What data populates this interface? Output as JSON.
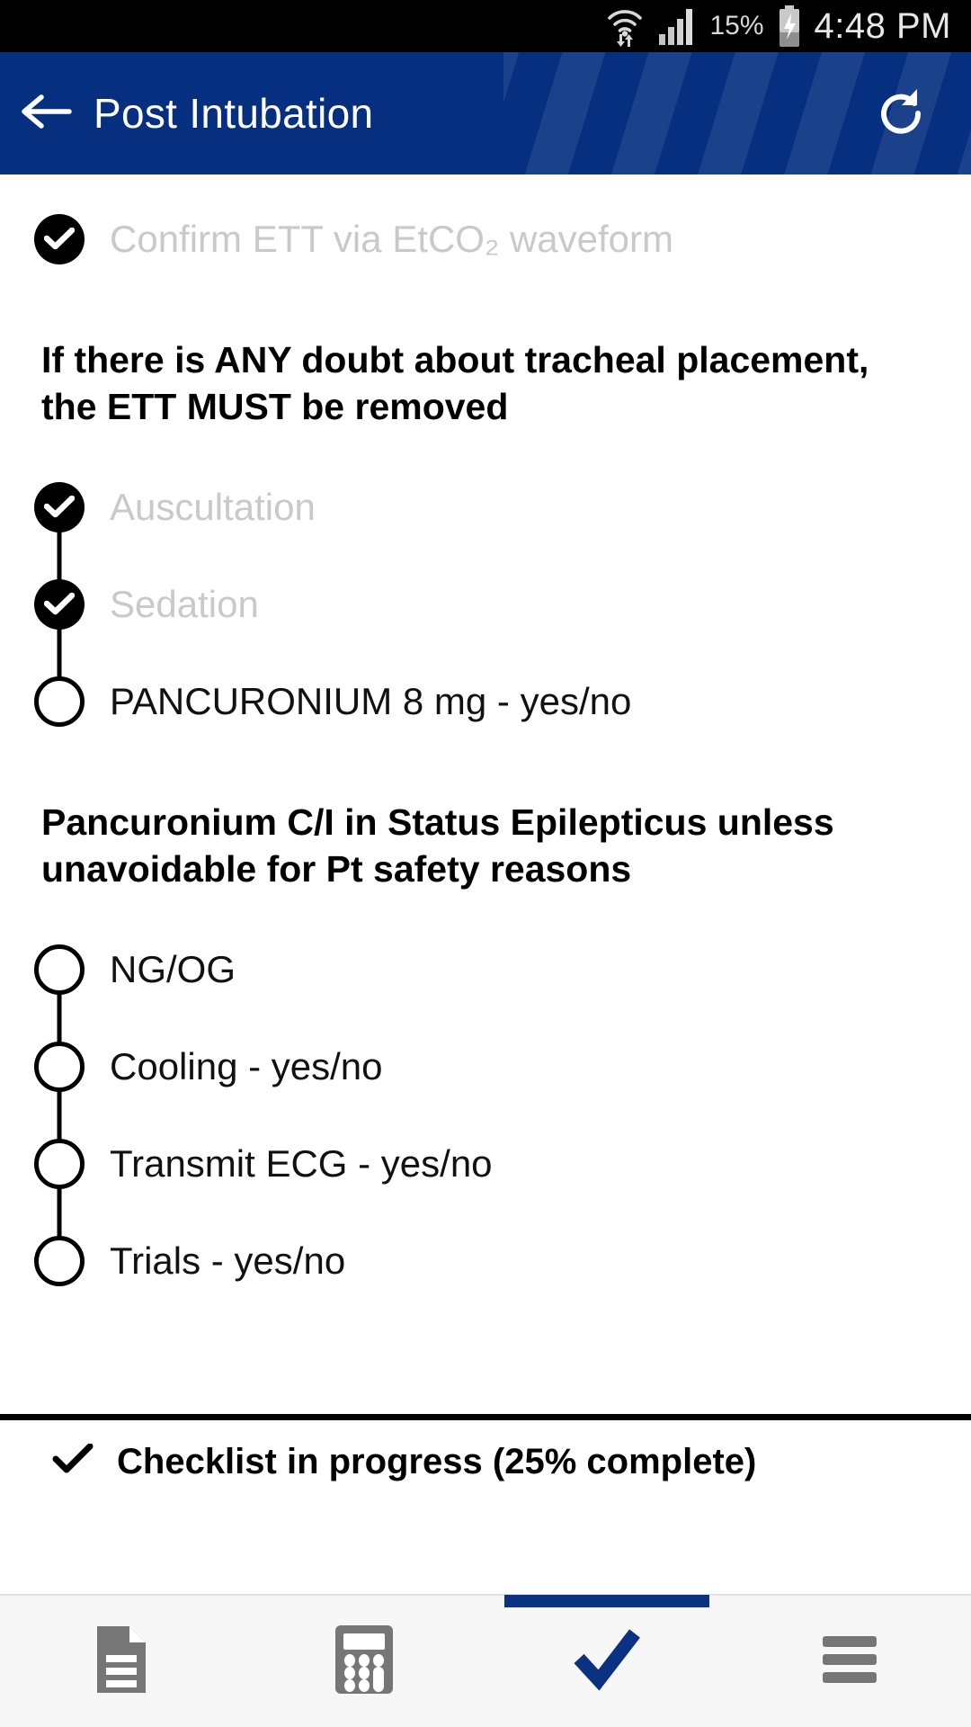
{
  "statusbar": {
    "wifi_icon": "wifi-transfer-icon",
    "signal_icon": "cellular-signal-icon",
    "battery_percent": "15%",
    "battery_icon": "battery-charging-icon",
    "time": "4:48 PM"
  },
  "appbar": {
    "back_icon": "back-arrow-icon",
    "title": "Post Intubation",
    "refresh_icon": "refresh-icon",
    "bg_color": "#062f7f"
  },
  "checklist": {
    "items": [
      {
        "label": "Confirm ETT via EtCO₂ waveform",
        "state": "done",
        "connector": "none"
      },
      {
        "label": "Auscultation",
        "state": "done",
        "connector": "below"
      },
      {
        "label": "Sedation",
        "state": "done",
        "connector": "both"
      },
      {
        "label": "PANCURONIUM 8 mg - yes/no",
        "state": "todo",
        "connector": "above"
      },
      {
        "label": "NG/OG",
        "state": "todo",
        "connector": "below"
      },
      {
        "label": "Cooling - yes/no",
        "state": "todo",
        "connector": "both"
      },
      {
        "label": "Transmit ECG - yes/no",
        "state": "todo",
        "connector": "both"
      },
      {
        "label": "Trials - yes/no",
        "state": "todo",
        "connector": "above"
      }
    ],
    "notes": {
      "ett_warning": "If there is ANY doubt about tracheal placement, the ETT MUST be removed",
      "pancuronium_warning": "Pancuronium C/I in Status Epilepticus unless unavoidable for Pt safety reasons"
    }
  },
  "progress": {
    "check_icon": "checkmark-icon",
    "text": "Checklist in progress (25% complete)",
    "percent": "25%"
  },
  "bottomnav": {
    "items": [
      {
        "icon": "document-icon",
        "active": false
      },
      {
        "icon": "calculator-icon",
        "active": false
      },
      {
        "icon": "checklist-check-icon",
        "active": true
      },
      {
        "icon": "hamburger-menu-icon",
        "active": false
      }
    ],
    "active_color": "#0b3282",
    "inactive_color": "#767676"
  }
}
